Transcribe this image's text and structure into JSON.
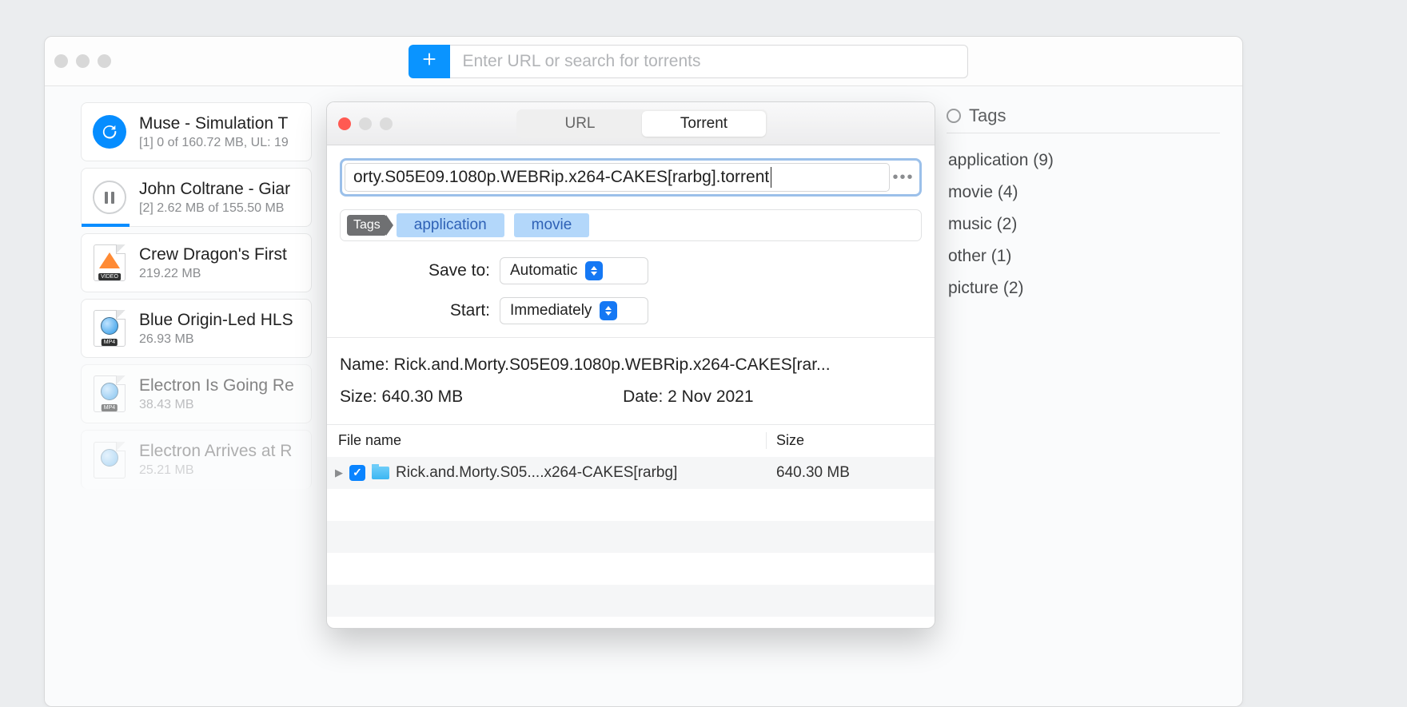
{
  "toolbar": {
    "search_placeholder": "Enter URL or search for torrents"
  },
  "downloads": [
    {
      "title": "Muse - Simulation T",
      "sub": "[1] 0 of 160.72 MB, UL: 19"
    },
    {
      "title": "John Coltrane - Giar",
      "sub": "[2] 2.62 MB of 155.50 MB"
    },
    {
      "title": "Crew Dragon's First",
      "sub": "219.22 MB"
    },
    {
      "title": "Blue Origin-Led HLS",
      "sub": "26.93 MB"
    },
    {
      "title": "Electron Is Going Re",
      "sub": "38.43 MB"
    },
    {
      "title": "Electron Arrives at R",
      "sub": "25.21 MB"
    }
  ],
  "tags_header": "Tags",
  "tags": [
    "application (9)",
    "movie (4)",
    "music (2)",
    "other (1)",
    "picture (2)"
  ],
  "dialog": {
    "tab_url": "URL",
    "tab_torrent": "Torrent",
    "url_value": "orty.S05E09.1080p.WEBRip.x264-CAKES[rarbg].torrent",
    "tags_label": "Tags",
    "chips": [
      "application",
      "movie"
    ],
    "save_to_label": "Save to:",
    "save_to_value": "Automatic",
    "start_label": "Start:",
    "start_value": "Immediately",
    "name_line": "Name: Rick.and.Morty.S05E09.1080p.WEBRip.x264-CAKES[rar...",
    "size_line": "Size: 640.30 MB",
    "date_line": "Date: 2 Nov 2021",
    "col_filename": "File name",
    "col_size": "Size",
    "row_name": "Rick.and.Morty.S05....x264-CAKES[rarbg]",
    "row_size": "640.30 MB"
  }
}
